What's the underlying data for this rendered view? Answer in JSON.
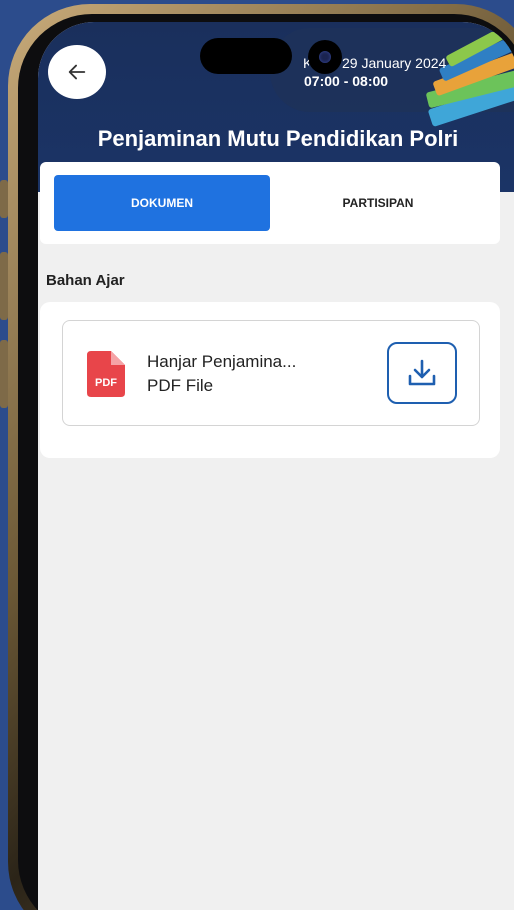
{
  "header": {
    "date": "29 January 2024",
    "day": "K",
    "time": "07:00 - 08:00",
    "title": "Penjaminan Mutu Pendidikan Polri"
  },
  "tabs": [
    {
      "label": "DOKUMEN",
      "active": true
    },
    {
      "label": "PARTISIPAN",
      "active": false
    }
  ],
  "section": {
    "label": "Bahan Ajar"
  },
  "documents": [
    {
      "name": "Hanjar  Penjamina...",
      "type": "PDF File",
      "badge": "PDF",
      "icon": "pdf-file-icon",
      "action_icon": "download-icon"
    }
  ],
  "colors": {
    "header_bg": "#1b3466",
    "accent": "#1f72e0",
    "pdf_red": "#e8454a",
    "download_border": "#1e5fb0",
    "page_bg": "#f0f0f0"
  }
}
